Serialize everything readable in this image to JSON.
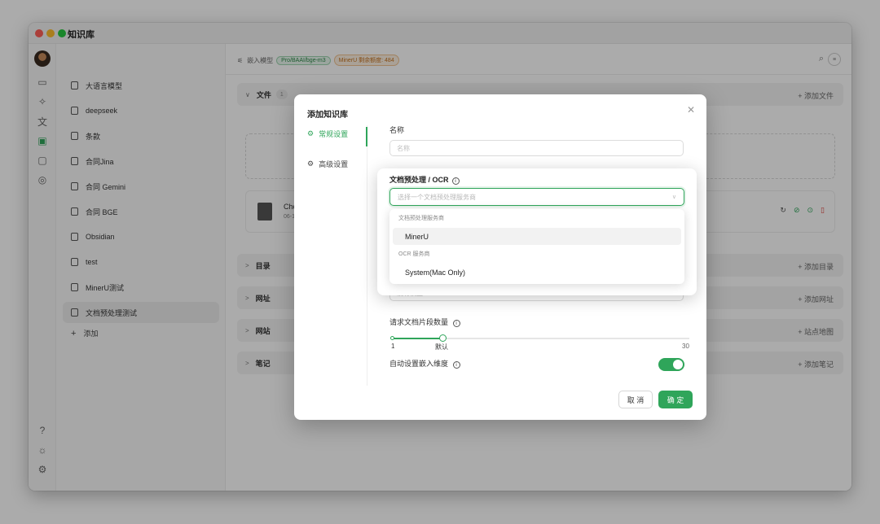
{
  "app": {
    "title": "知识库"
  },
  "kb_list": {
    "items": [
      {
        "label": "大语言模型"
      },
      {
        "label": "deepseek"
      },
      {
        "label": "条款"
      },
      {
        "label": "合同Jina"
      },
      {
        "label": "合同 Gemini"
      },
      {
        "label": "合同 BGE"
      },
      {
        "label": "Obsidian"
      },
      {
        "label": "test"
      },
      {
        "label": "MinerU测试"
      },
      {
        "label": "文档预处理测试"
      }
    ],
    "add_label": "添加"
  },
  "topbar": {
    "embed_label": "嵌入模型",
    "model_tag": "Pro/BAAI/bge-m3",
    "mineru_tag": "MinerU 剩余额度: 484"
  },
  "sections": {
    "files": {
      "title": "文件",
      "count": "1",
      "action": "添加文件"
    },
    "dirs": {
      "title": "目录",
      "action": "添加目录"
    },
    "urls": {
      "title": "网址",
      "action": "添加网址"
    },
    "sites": {
      "title": "网站",
      "action": "站点地图"
    },
    "notes": {
      "title": "笔记",
      "action": "添加笔记"
    }
  },
  "file": {
    "name": "Cherry Stu",
    "time": "06-16 10:37"
  },
  "modal": {
    "title": "添加知识库",
    "nav": {
      "general": "常规设置",
      "advanced": "高级设置"
    },
    "name_label": "名称",
    "name_placeholder": "名称",
    "model_placeholder": "没有模型",
    "chunk_label": "请求文档片段数量",
    "slider": {
      "min": "1",
      "default_label": "默认",
      "max": "30",
      "value": 6
    },
    "auto_dim_label": "自动设置嵌入维度",
    "auto_dim_on": true,
    "cancel": "取 消",
    "ok": "确 定"
  },
  "ocr": {
    "label": "文档预处理 / OCR",
    "placeholder": "选择一个文档预处理服务商",
    "groups": [
      {
        "title": "文档预处理服务商",
        "options": [
          "MinerU"
        ]
      },
      {
        "title": "OCR 服务商",
        "options": [
          "System(Mac Only)"
        ]
      }
    ]
  },
  "colors": {
    "accent": "#2fa55a",
    "orange": "#c4721e"
  }
}
